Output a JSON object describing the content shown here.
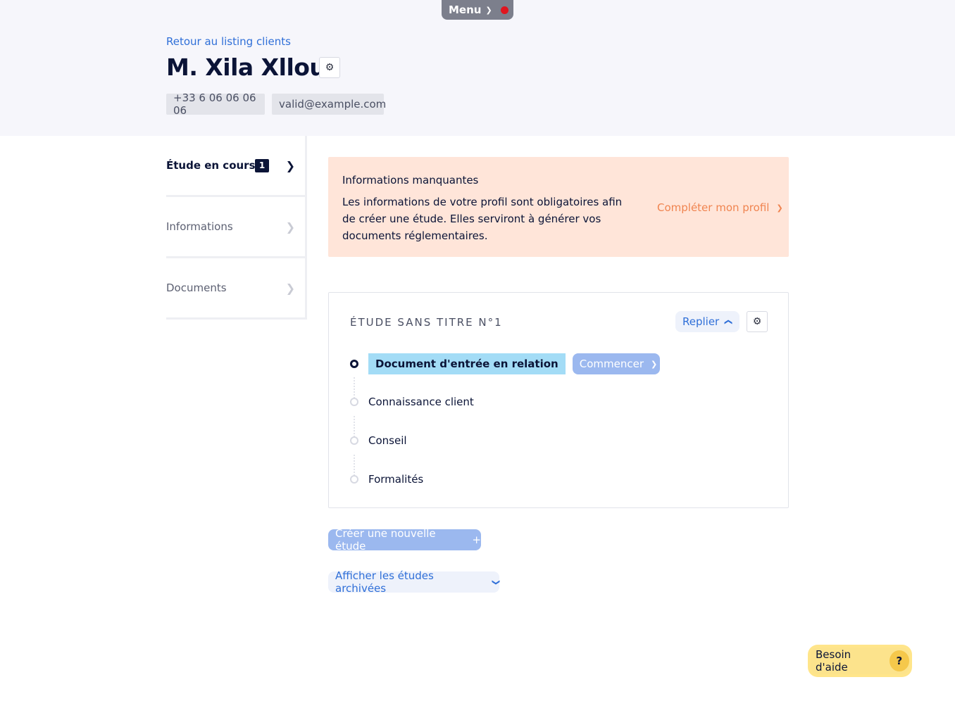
{
  "menu": {
    "label": "Menu",
    "chevron_icon": "chevron-down-icon",
    "notification_color": "#e0161f"
  },
  "header": {
    "back_link": "Retour au listing clients",
    "client_name": "M. Xila Xllou",
    "phone": "+33 6 06 06 06 06",
    "email": "valid@example.com"
  },
  "sidebar": {
    "items": [
      {
        "label": "Étude en cours",
        "badge": "1",
        "active": true
      },
      {
        "label": "Informations",
        "active": false
      },
      {
        "label": "Documents",
        "active": false
      }
    ]
  },
  "alert": {
    "title": "Informations manquantes",
    "text": "Les informations de votre profil sont obligatoires afin de créer une étude. Elles serviront à générer vos documents réglementaires.",
    "link": "Compléter mon profil",
    "color": "#f08450",
    "background": "#ffe5d9"
  },
  "study": {
    "title": "ÉTUDE SANS TITRE N°1",
    "collapse_label": "Replier",
    "steps": [
      {
        "label": "Document d'entrée en relation",
        "current": true
      },
      {
        "label": "Connaissance client",
        "current": false
      },
      {
        "label": "Conseil",
        "current": false
      },
      {
        "label": "Formalités",
        "current": false
      }
    ],
    "start_label": "Commencer"
  },
  "actions": {
    "new_study": "Créer une nouvelle étude",
    "archived": "Afficher les études archivées"
  },
  "help": {
    "label": "Besoin d'aide",
    "icon_text": "?"
  },
  "colors": {
    "accent": "#2f6fd8",
    "primary_text": "#0b1437",
    "disabled_button": "#9bb8ef"
  }
}
